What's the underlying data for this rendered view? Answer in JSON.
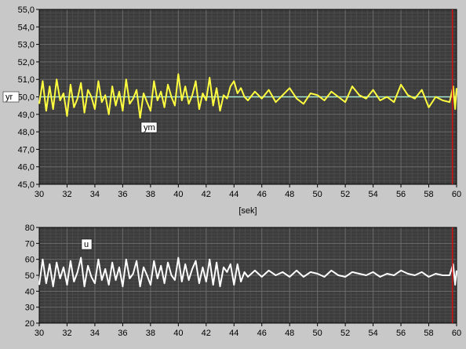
{
  "colors": {
    "panel_bg": "#c8c8c8",
    "plot_bg": "#3c3c3c",
    "grid_minor": "#4a4a4a",
    "grid_major": "#6a6a6a",
    "ym_trace": "#ffff40",
    "yr_trace": "#a8e8d0",
    "u_trace": "#ffffff",
    "cursor": "#d01010"
  },
  "chart_data": [
    {
      "type": "line",
      "name": "top-chart",
      "xlabel": "[sek]",
      "xlim": [
        30,
        60
      ],
      "ylim": [
        45,
        55
      ],
      "x_ticks": [
        30,
        32,
        34,
        36,
        38,
        40,
        42,
        44,
        46,
        48,
        50,
        52,
        54,
        56,
        58,
        60
      ],
      "y_ticks": [
        45,
        46,
        47,
        48,
        49,
        50,
        51,
        52,
        53,
        54,
        55
      ],
      "y_tick_labels": [
        "45,0",
        "46,0",
        "47,0",
        "48,0",
        "49,0",
        "50,0",
        "51,0",
        "52,0",
        "53,0",
        "54,0",
        "55,0"
      ],
      "grid": true,
      "cursor_x": 59.7,
      "series": [
        {
          "name": "yr",
          "x": [
            30,
            60
          ],
          "y": [
            50.0,
            50.0
          ]
        },
        {
          "name": "ym",
          "x": [
            30.0,
            30.25,
            30.5,
            30.75,
            31.0,
            31.25,
            31.5,
            31.75,
            32.0,
            32.25,
            32.5,
            32.75,
            33.0,
            33.25,
            33.5,
            33.75,
            34.0,
            34.25,
            34.5,
            34.75,
            35.0,
            35.25,
            35.5,
            35.75,
            36.0,
            36.25,
            36.5,
            36.75,
            37.0,
            37.25,
            37.5,
            37.75,
            38.0,
            38.25,
            38.5,
            38.75,
            39.0,
            39.25,
            39.5,
            39.75,
            40.0,
            40.25,
            40.5,
            40.75,
            41.0,
            41.25,
            41.5,
            41.75,
            42.0,
            42.25,
            42.5,
            42.75,
            43.0,
            43.25,
            43.5,
            43.75,
            44.0,
            44.25,
            44.5,
            44.75,
            45.0,
            45.5,
            46.0,
            46.5,
            47.0,
            47.5,
            48.0,
            48.5,
            49.0,
            49.5,
            50.0,
            50.5,
            51.0,
            51.5,
            52.0,
            52.5,
            53.0,
            53.5,
            54.0,
            54.5,
            55.0,
            55.5,
            56.0,
            56.5,
            57.0,
            57.5,
            58.0,
            58.5,
            59.0,
            59.5,
            59.75,
            59.9,
            60.0
          ],
          "y": [
            49.6,
            50.9,
            49.2,
            50.6,
            49.3,
            51.0,
            49.8,
            50.2,
            48.9,
            50.7,
            49.4,
            49.9,
            50.8,
            49.1,
            50.4,
            50.0,
            49.3,
            50.9,
            49.7,
            50.1,
            49.0,
            50.6,
            49.5,
            50.3,
            49.2,
            51.0,
            49.6,
            49.9,
            50.4,
            48.8,
            50.2,
            49.7,
            49.2,
            50.9,
            49.8,
            50.3,
            49.4,
            50.7,
            50.0,
            49.5,
            51.3,
            49.8,
            50.6,
            49.6,
            50.1,
            50.9,
            49.3,
            50.2,
            49.8,
            51.1,
            49.5,
            50.5,
            49.2,
            50.1,
            49.9,
            50.6,
            50.9,
            50.2,
            50.5,
            50.0,
            49.8,
            50.3,
            49.9,
            50.4,
            49.7,
            50.1,
            50.5,
            49.9,
            49.6,
            50.2,
            50.1,
            49.8,
            50.3,
            50.0,
            49.7,
            50.6,
            50.1,
            49.9,
            50.4,
            49.8,
            50.0,
            49.7,
            50.7,
            50.1,
            49.9,
            50.4,
            49.4,
            50.0,
            49.8,
            49.7,
            50.6,
            49.3,
            50.5
          ]
        }
      ],
      "annotations": [
        {
          "text": "yr",
          "target": "yr"
        },
        {
          "text": "ym",
          "target": "ym"
        }
      ]
    },
    {
      "type": "line",
      "name": "bottom-chart",
      "xlim": [
        30,
        60
      ],
      "ylim": [
        20,
        80
      ],
      "x_ticks": [
        30,
        32,
        34,
        36,
        38,
        40,
        42,
        44,
        46,
        48,
        50,
        52,
        54,
        56,
        58,
        60
      ],
      "y_ticks": [
        20,
        30,
        40,
        50,
        60,
        70,
        80
      ],
      "y_tick_labels": [
        "20",
        "30",
        "40",
        "50",
        "60",
        "70",
        "80"
      ],
      "grid": true,
      "cursor_x": 59.7,
      "series": [
        {
          "name": "u",
          "x": [
            30.0,
            30.25,
            30.5,
            30.75,
            31.0,
            31.25,
            31.5,
            31.75,
            32.0,
            32.25,
            32.5,
            32.75,
            33.0,
            33.25,
            33.5,
            33.75,
            34.0,
            34.25,
            34.5,
            34.75,
            35.0,
            35.25,
            35.5,
            35.75,
            36.0,
            36.25,
            36.5,
            36.75,
            37.0,
            37.25,
            37.5,
            37.75,
            38.0,
            38.25,
            38.5,
            38.75,
            39.0,
            39.25,
            39.5,
            39.75,
            40.0,
            40.25,
            40.5,
            40.75,
            41.0,
            41.25,
            41.5,
            41.75,
            42.0,
            42.25,
            42.5,
            42.75,
            43.0,
            43.25,
            43.5,
            43.75,
            44.0,
            44.25,
            44.5,
            44.75,
            45.0,
            45.5,
            46.0,
            46.5,
            47.0,
            47.5,
            48.0,
            48.5,
            49.0,
            49.5,
            50.0,
            50.5,
            51.0,
            51.5,
            52.0,
            52.5,
            53.0,
            53.5,
            54.0,
            54.5,
            55.0,
            55.5,
            56.0,
            56.5,
            57.0,
            57.5,
            58.0,
            58.5,
            59.0,
            59.5,
            59.75,
            59.9,
            60.0
          ],
          "y": [
            44,
            60,
            45,
            57,
            43,
            58,
            48,
            55,
            44,
            59,
            46,
            52,
            61,
            43,
            56,
            49,
            45,
            60,
            47,
            54,
            44,
            58,
            47,
            55,
            43,
            60,
            48,
            51,
            59,
            43,
            55,
            50,
            44,
            59,
            48,
            56,
            45,
            58,
            50,
            47,
            61,
            46,
            57,
            47,
            54,
            59,
            45,
            55,
            46,
            60,
            44,
            58,
            43,
            55,
            52,
            57,
            44,
            57,
            46,
            52,
            49,
            53,
            49,
            53,
            50,
            52,
            49,
            53,
            49,
            52,
            51,
            49,
            53,
            50,
            49,
            52,
            51,
            50,
            52,
            49,
            51,
            50,
            53,
            51,
            50,
            52,
            49,
            51,
            50,
            50,
            57,
            44,
            53
          ]
        }
      ],
      "annotations": [
        {
          "text": "u",
          "target": "u"
        }
      ]
    }
  ]
}
